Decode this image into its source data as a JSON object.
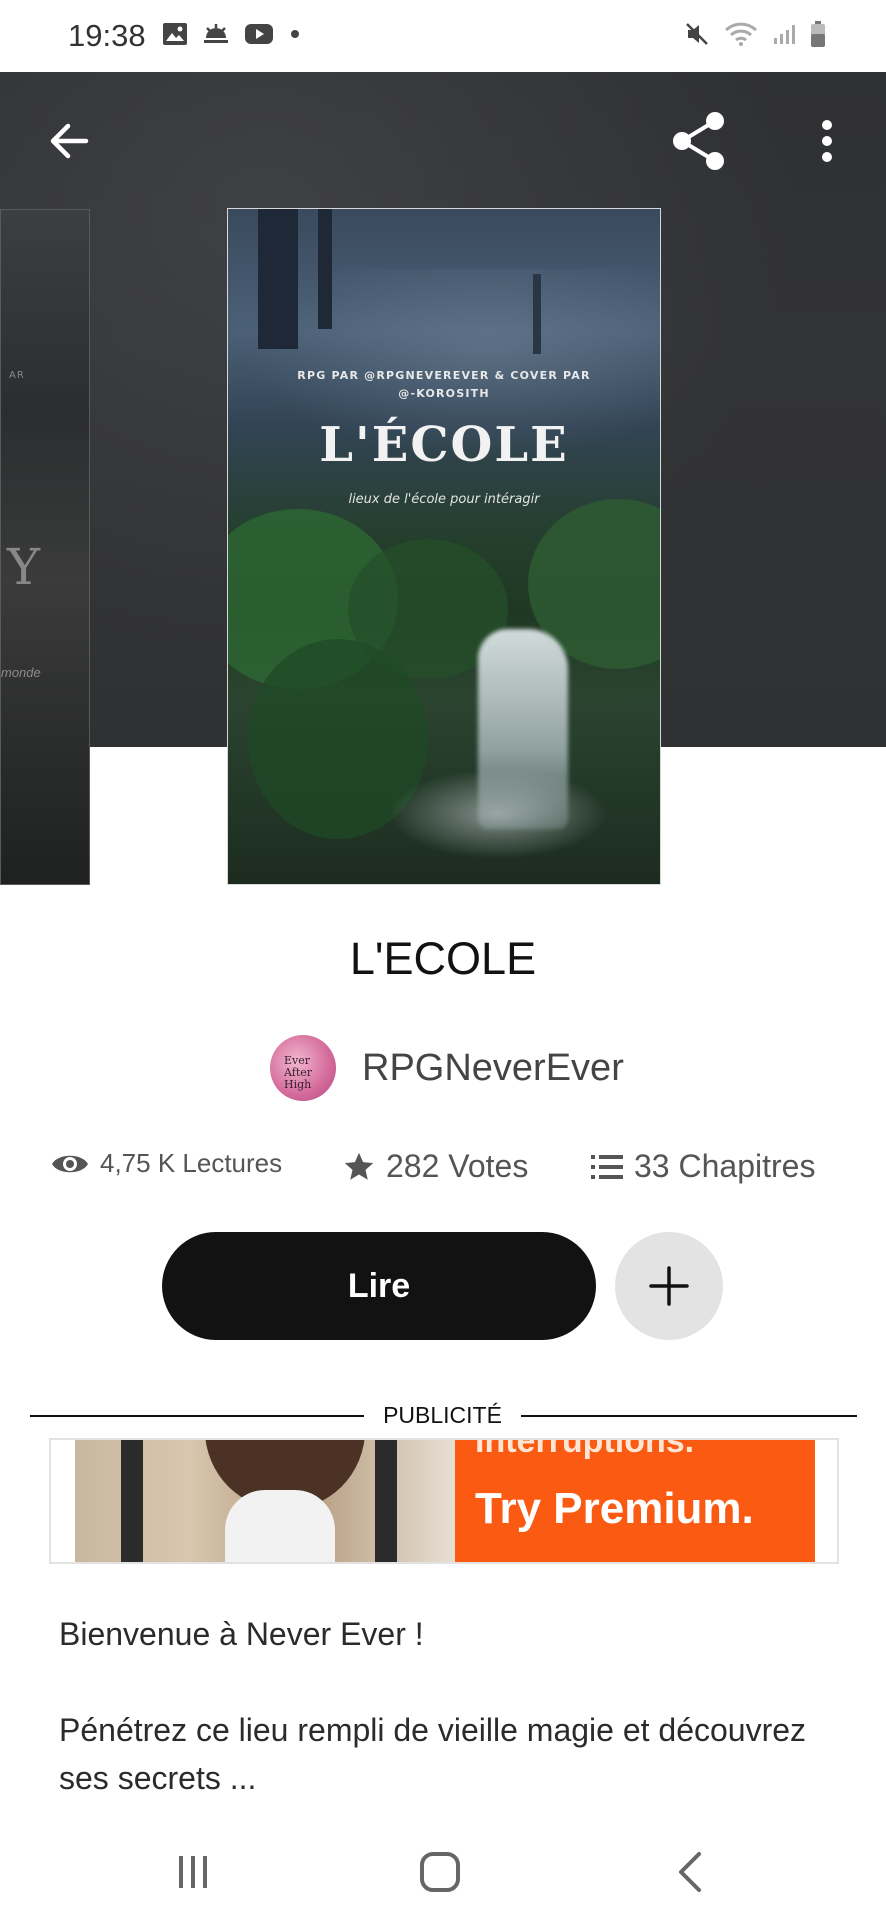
{
  "status_bar": {
    "time": "19:38",
    "left_icons": [
      "gallery-icon",
      "weather-icon",
      "youtube-icon",
      "dot-icon"
    ],
    "right_icons": [
      "mute-icon",
      "wifi-icon",
      "signal-icon",
      "battery-icon"
    ]
  },
  "toolbar": {
    "back_icon": "arrow-left-icon",
    "share_icon": "share-icon",
    "menu_icon": "more-vertical-icon"
  },
  "side_cover": {
    "text_top": "AR",
    "letter": "Y",
    "text_bottom": "monde"
  },
  "cover": {
    "credit_line1": "RPG PAR @RPGNEVEREVER &  COVER PAR",
    "credit_line2": "@-KOROSITH",
    "title": "L'ÉCOLE",
    "subtitle": "lieux de l'école pour intéragir"
  },
  "story": {
    "title": "L'ECOLE",
    "author": "RPGNeverEver",
    "avatar_text": "Ever After High"
  },
  "stats": {
    "reads": "4,75 K Lectures",
    "votes": "282 Votes",
    "chapters": "33 Chapitres"
  },
  "actions": {
    "read_label": "Lire",
    "add_icon": "plus-icon"
  },
  "ad": {
    "label": "PUBLICITÉ",
    "top_text": "Interruptions.",
    "cta": "Try Premium."
  },
  "description": {
    "line1": "Bienvenue à Never Ever !",
    "line2": "Pénétrez ce lieu rempli de vieille magie et découvrez ses secrets ..."
  },
  "nav": {
    "recents_icon": "recents-icon",
    "home_icon": "home-icon",
    "back_icon": "back-chevron-icon"
  },
  "colors": {
    "hero_bg": "#303133",
    "primary_button": "#121212",
    "secondary_button": "#e3e3e3",
    "ad_orange": "#fb5a12"
  }
}
